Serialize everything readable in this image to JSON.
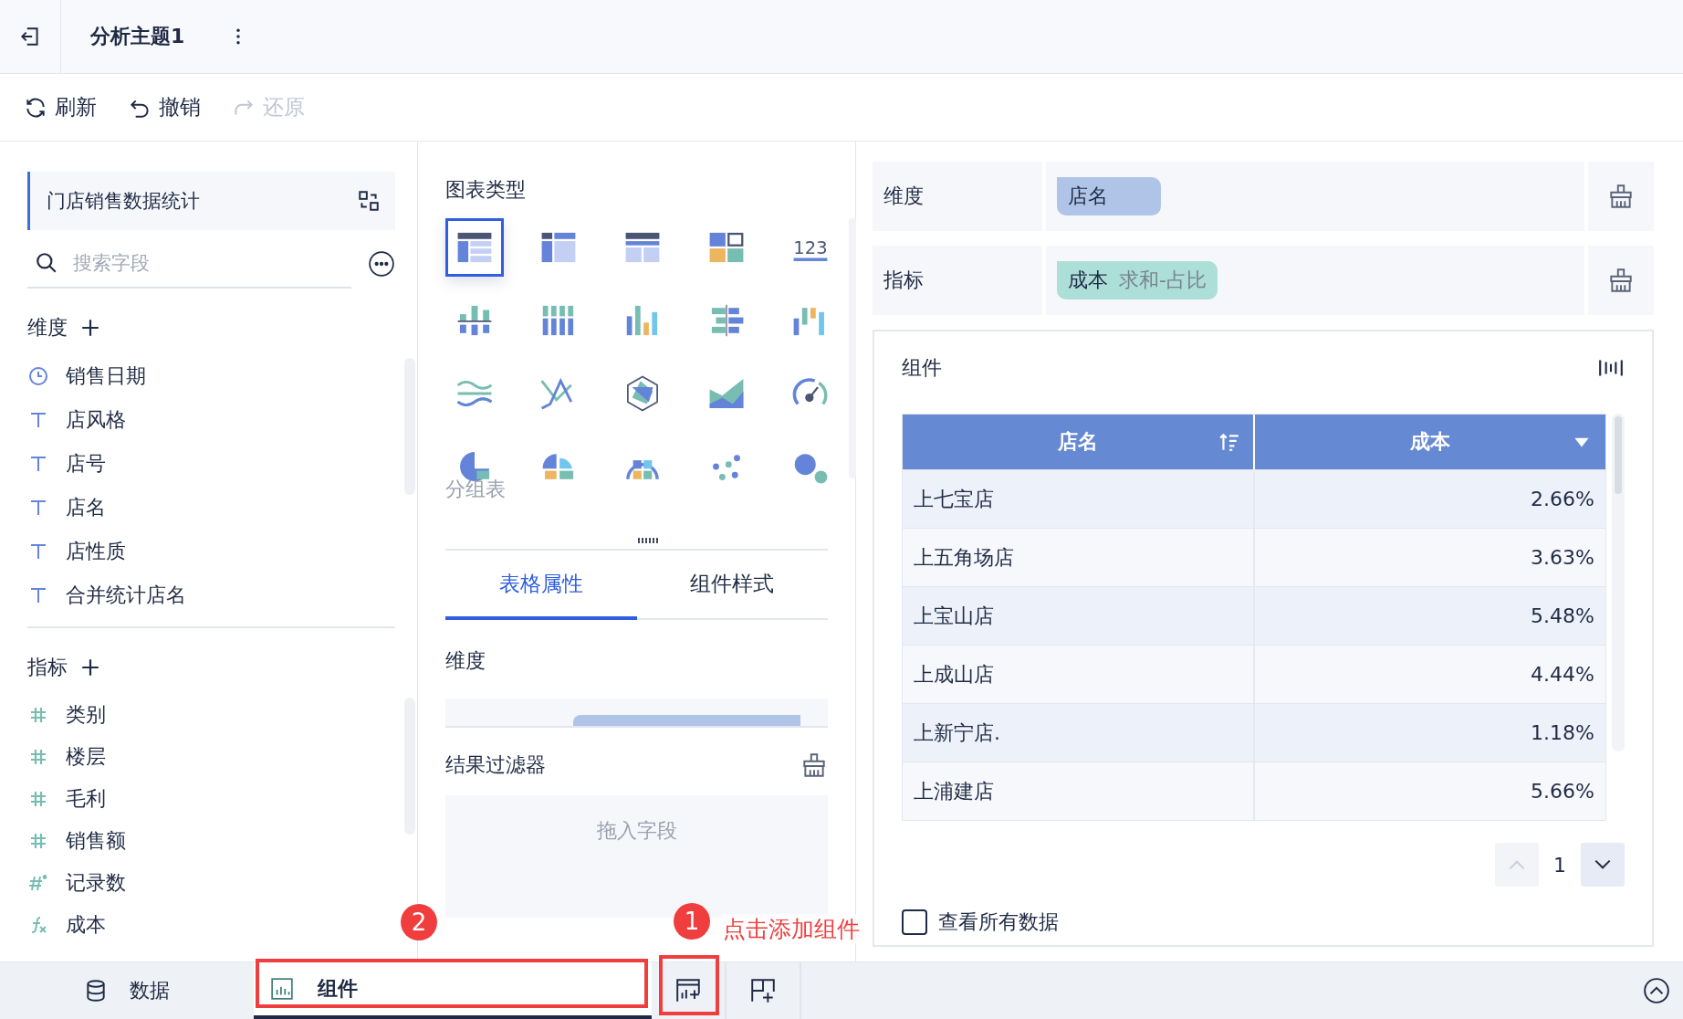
{
  "header": {
    "title": "分析主题1"
  },
  "toolbar": [
    {
      "kind": "refresh",
      "label": "刷新",
      "disabled": false
    },
    {
      "kind": "undo",
      "label": "撤销",
      "disabled": false
    },
    {
      "kind": "redo",
      "label": "还原",
      "disabled": true
    }
  ],
  "sidebar": {
    "dataset": "门店销售数据统计",
    "search": {
      "placeholder": "搜索字段"
    },
    "dimensions": {
      "title": "维度",
      "items": [
        {
          "kind": "date",
          "label": "销售日期"
        },
        {
          "kind": "text",
          "label": "店风格"
        },
        {
          "kind": "text",
          "label": "店号"
        },
        {
          "kind": "text",
          "label": "店名"
        },
        {
          "kind": "text",
          "label": "店性质"
        },
        {
          "kind": "text",
          "label": "合并统计店名"
        }
      ]
    },
    "measures": {
      "title": "指标",
      "items": [
        {
          "kind": "number",
          "label": "类别"
        },
        {
          "kind": "number",
          "label": "楼层"
        },
        {
          "kind": "number",
          "label": "毛利"
        },
        {
          "kind": "number",
          "label": "销售额"
        },
        {
          "kind": "count",
          "label": "记录数"
        },
        {
          "kind": "formula",
          "label": "成本"
        }
      ]
    }
  },
  "chart_panel": {
    "title": "图表类型",
    "types": [
      {
        "kind": "group-table",
        "selected": true
      },
      {
        "kind": "cross-table",
        "selected": false
      },
      {
        "kind": "detail-table",
        "selected": false
      },
      {
        "kind": "card",
        "selected": false
      },
      {
        "kind": "number",
        "text": "123",
        "selected": false
      },
      {
        "kind": "diverging-column",
        "selected": false
      },
      {
        "kind": "stacked-column",
        "selected": false
      },
      {
        "kind": "column",
        "selected": false
      },
      {
        "kind": "bidirectional-bar",
        "selected": false
      },
      {
        "kind": "waterfall",
        "selected": false
      },
      {
        "kind": "band-line",
        "selected": false
      },
      {
        "kind": "line",
        "selected": false
      },
      {
        "kind": "radar",
        "selected": false
      },
      {
        "kind": "area",
        "selected": false
      },
      {
        "kind": "gauge",
        "selected": false
      },
      {
        "kind": "pie",
        "selected": false
      },
      {
        "kind": "rose",
        "selected": false
      },
      {
        "kind": "sunburst",
        "selected": false
      },
      {
        "kind": "scatter",
        "selected": false
      },
      {
        "kind": "bubble",
        "selected": false
      }
    ],
    "caption": "分组表",
    "tabs": [
      {
        "label": "表格属性",
        "selected": true
      },
      {
        "label": "组件样式",
        "selected": false
      }
    ],
    "dimension_title": "维度",
    "filter": {
      "title": "结果过滤器",
      "placeholder": "拖入字段"
    }
  },
  "fields": [
    {
      "label": "维度",
      "pills": [
        {
          "kind": "dimension",
          "name": "店名"
        }
      ]
    },
    {
      "label": "指标",
      "pills": [
        {
          "kind": "measure",
          "name": "成本",
          "summary": "求和-占比"
        }
      ]
    }
  ],
  "widget": {
    "title": "组件",
    "table": {
      "columns": [
        {
          "label": "店名",
          "kind": "sort"
        },
        {
          "label": "成本",
          "kind": "dropdown"
        }
      ],
      "rows": [
        [
          "上七宝店",
          "2.66%"
        ],
        [
          "上五角场店",
          "3.63%"
        ],
        [
          "上宝山店",
          "5.48%"
        ],
        [
          "上成山店",
          "4.44%"
        ],
        [
          "上新宁店.",
          "1.18%"
        ],
        [
          "上浦建店",
          "5.66%"
        ]
      ]
    },
    "page": "1",
    "show_all": {
      "label": "查看所有数据",
      "checked": false
    }
  },
  "bottom_tabs": [
    {
      "kind": "data",
      "label": "数据",
      "selected": false
    },
    {
      "kind": "widget",
      "label": "组件",
      "selected": true
    }
  ],
  "annotations": [
    {
      "number": "2"
    },
    {
      "number": "1",
      "text": "点击添加组件"
    }
  ]
}
